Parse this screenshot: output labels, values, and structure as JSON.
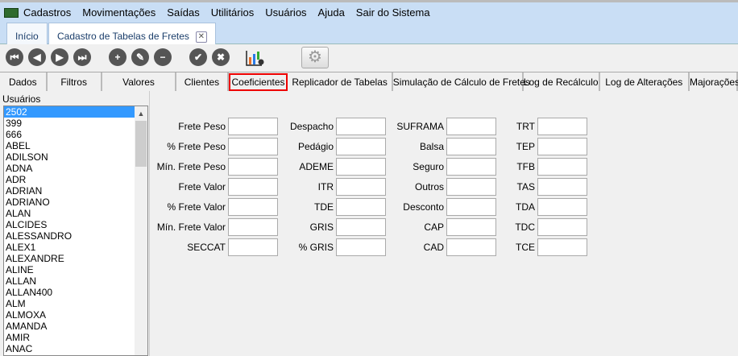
{
  "menu": [
    "Cadastros",
    "Movimentações",
    "Saídas",
    "Utilitários",
    "Usuários",
    "Ajuda",
    "Sair do Sistema"
  ],
  "doc_tabs": [
    "Início",
    "Cadastro de Tabelas de Fretes"
  ],
  "close_glyph": "✕",
  "toolbar": {
    "first": "⏮",
    "prev": "◀",
    "next": "▶",
    "last": "⏭",
    "add": "+",
    "edit": "✎",
    "remove": "−",
    "confirm": "✔",
    "cancel": "✖",
    "settings": "⚙"
  },
  "tabs": [
    "Dados",
    "Filtros",
    "Valores",
    "Clientes",
    "Coeficientes",
    "Replicador de Tabelas",
    "Simulação de Cálculo de Fretes",
    "Log de Recálculo",
    "Log de Alterações",
    "Majorações"
  ],
  "active_tab": "Coeficientes",
  "users": {
    "label": "Usuários",
    "selected": "2502",
    "items": [
      "2502",
      "399",
      "666",
      "ABEL",
      "ADILSON",
      "ADNA",
      "ADR",
      "ADRIAN",
      "ADRIANO",
      "ALAN",
      "ALCIDES",
      "ALESSANDRO",
      "ALEX1",
      "ALEXANDRE",
      "ALINE",
      "ALLAN",
      "ALLAN400",
      "ALM",
      "ALMOXA",
      "AMANDA",
      "AMIR",
      "ANAC"
    ]
  },
  "fields": [
    [
      "Frete Peso",
      "% Frete Peso",
      "Mín. Frete Peso",
      "Frete Valor",
      "% Frete Valor",
      "Mín. Frete Valor",
      "SECCAT"
    ],
    [
      "Despacho",
      "Pedágio",
      "ADEME",
      "ITR",
      "TDE",
      "GRIS",
      "% GRIS"
    ],
    [
      "SUFRAMA",
      "Balsa",
      "Seguro",
      "Outros",
      "Desconto",
      "CAP",
      "CAD"
    ],
    [
      "TRT",
      "TEP",
      "TFB",
      "TAS",
      "TDA",
      "TDC",
      "TCE"
    ]
  ]
}
